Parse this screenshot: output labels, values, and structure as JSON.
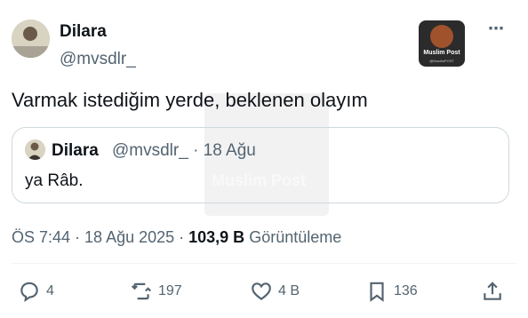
{
  "tweet": {
    "author_name": "Dilara",
    "author_handle": "@mvsdlr_",
    "text": "Varmak istediğim yerde, beklenen olayım",
    "quote": {
      "author_name": "Dilara",
      "meta": "@mvsdlr_ · 18 Ağu",
      "text": "ya Râb."
    },
    "time": "ÖS 7:44 · 18 Ağu 2025 · ",
    "views_value": "103,9 B",
    "views_label": " Görüntüleme",
    "actions": {
      "reply_count": "4",
      "retweet_count": "197",
      "like_count": "4 B",
      "bookmark_count": "136"
    }
  },
  "watermark": {
    "badge_title": "Muslim Post",
    "badge_handle": "@MuslimPOST",
    "overlay_text": "Muslim Post"
  },
  "more_icon": "⋯",
  "icons": [
    "reply-icon",
    "retweet-icon",
    "like-icon",
    "bookmark-icon",
    "share-icon",
    "more-icon"
  ]
}
